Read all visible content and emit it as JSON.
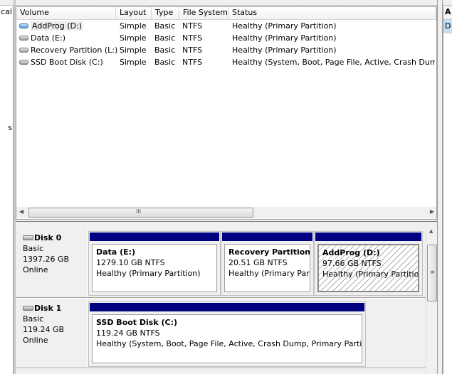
{
  "left_pane": {
    "text1": "cal",
    "text2": "s"
  },
  "volume_list": {
    "columns": [
      "Volume",
      "Layout",
      "Type",
      "File System",
      "Status"
    ],
    "rows": [
      {
        "volume": "AddProg (D:)",
        "layout": "Simple",
        "type": "Basic",
        "fs": "NTFS",
        "status": "Healthy (Primary Partition)",
        "selected": true
      },
      {
        "volume": "Data (E:)",
        "layout": "Simple",
        "type": "Basic",
        "fs": "NTFS",
        "status": "Healthy (Primary Partition)"
      },
      {
        "volume": "Recovery Partition (L:)",
        "layout": "Simple",
        "type": "Basic",
        "fs": "NTFS",
        "status": "Healthy (Primary Partition)"
      },
      {
        "volume": "SSD Boot Disk (C:)",
        "layout": "Simple",
        "type": "Basic",
        "fs": "NTFS",
        "status": "Healthy (System, Boot, Page File, Active, Crash Dump, Primary Partition)"
      }
    ]
  },
  "scroll_grip": "III",
  "disks": [
    {
      "name": "Disk 0",
      "type": "Basic",
      "size": "1397.26 GB",
      "state": "Online",
      "partitions": [
        {
          "name": "Data  (E:)",
          "size": "1279.10 GB NTFS",
          "status": "Healthy (Primary Partition)"
        },
        {
          "name": "Recovery Partition  (L:)",
          "size": "20.51 GB NTFS",
          "status": "Healthy (Primary Partition)"
        },
        {
          "name": "AddProg  (D:)",
          "size": "97.66 GB NTFS",
          "status": "Healthy (Primary Partition)",
          "selected": true
        }
      ]
    },
    {
      "name": "Disk 1",
      "type": "Basic",
      "size": "119.24 GB",
      "state": "Online",
      "partitions": [
        {
          "name": "SSD Boot Disk  (C:)",
          "size": "119.24 GB NTFS",
          "status": "Healthy (System, Boot, Page File, Active, Crash Dump, Primary Partition)"
        }
      ]
    }
  ],
  "right_pane": {
    "header": "A",
    "item": "D"
  },
  "colors": {
    "partition_bar": "#000080",
    "selection": "#c6dcf2"
  }
}
